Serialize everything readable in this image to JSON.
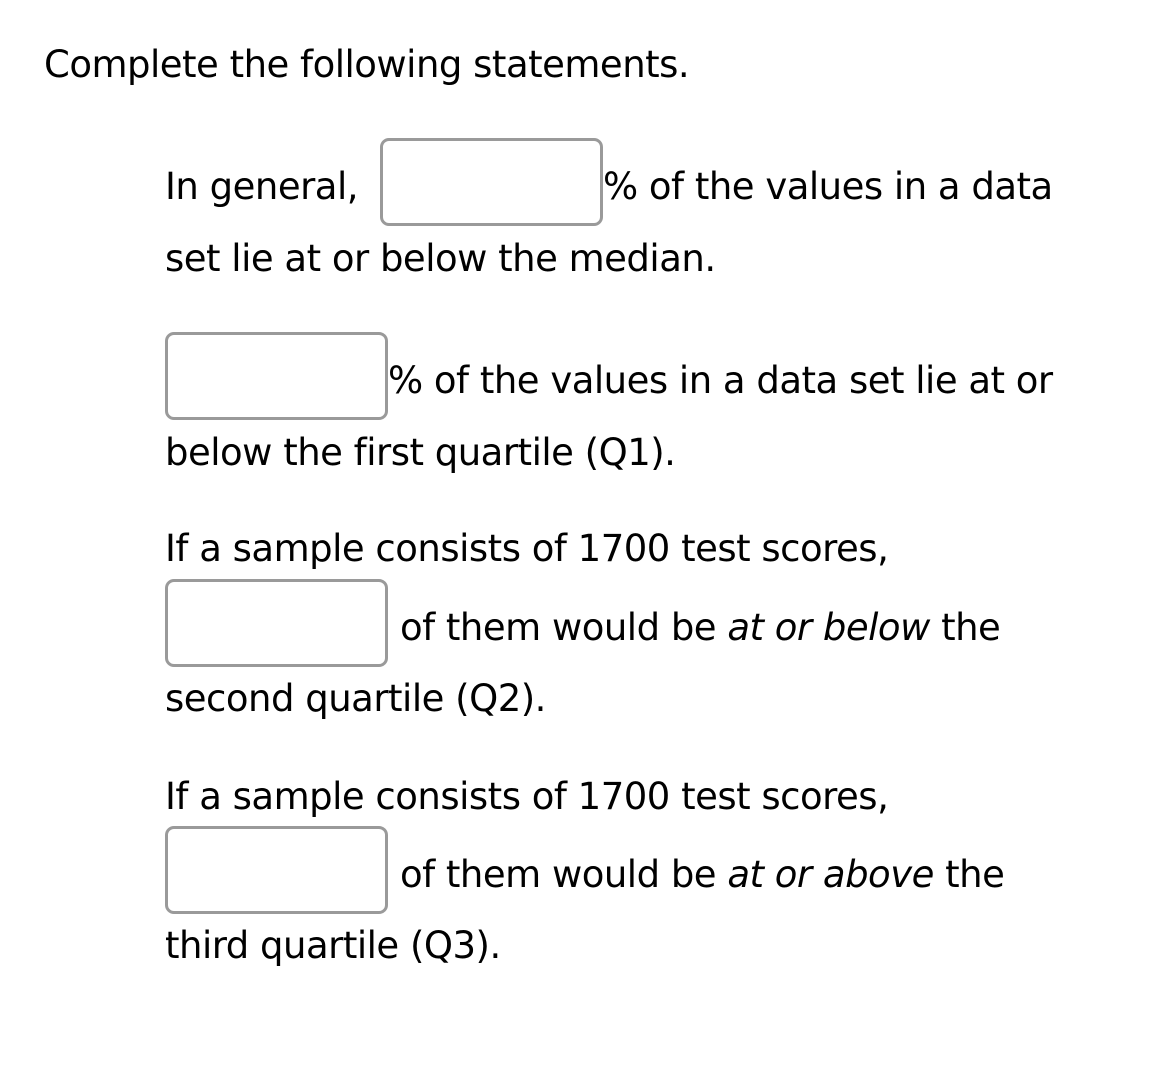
{
  "title": "Complete the following statements.",
  "statements": [
    {
      "before": "In general,",
      "input_value": "",
      "after": "% of the values in a data",
      "line2": "set lie at or below the median."
    },
    {
      "input_value": "",
      "after": "% of the values in a data set lie at or",
      "line2": "below the first quartile (Q1)."
    },
    {
      "intro": "If a sample consists of 1700 test scores,",
      "input_value": "",
      "after_pre": "of them would be ",
      "after_em": "at or below",
      "after_post": " the",
      "line2": "second quartile (Q2)."
    },
    {
      "intro": "If a sample consists of 1700 test scores,",
      "input_value": "",
      "after_pre": "of them would be ",
      "after_em": "at or above",
      "after_post": " the",
      "line2": "third quartile (Q3)."
    }
  ]
}
